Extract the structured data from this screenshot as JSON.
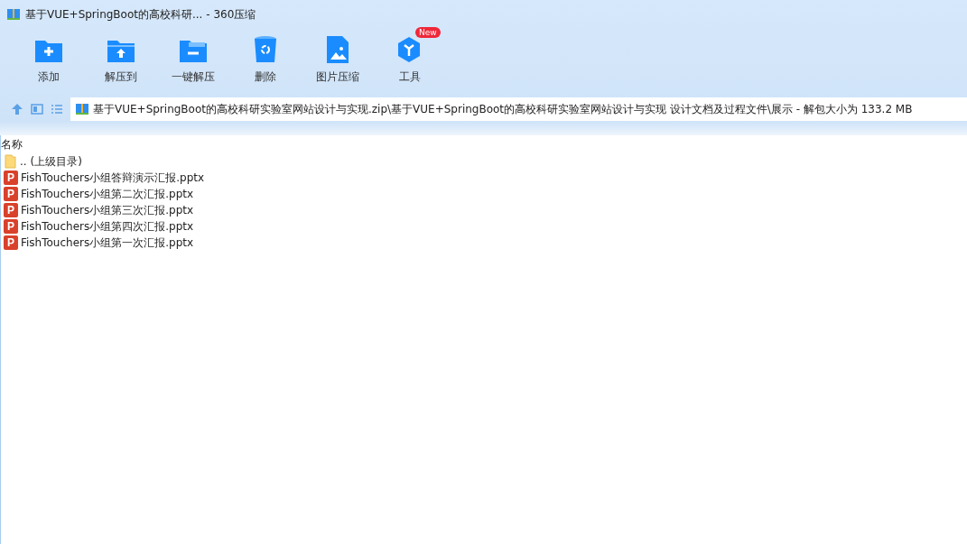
{
  "window": {
    "title": "基于VUE+SpringBoot的高校科研... - 360压缩"
  },
  "toolbar": [
    {
      "kind": "add",
      "label": "添加"
    },
    {
      "kind": "extract",
      "label": "解压到"
    },
    {
      "kind": "oneclick",
      "label": "一键解压"
    },
    {
      "kind": "delete",
      "label": "删除"
    },
    {
      "kind": "image",
      "label": "图片压缩"
    },
    {
      "kind": "tools",
      "label": "工具",
      "badge": "New"
    }
  ],
  "address": {
    "path": "基于VUE+SpringBoot的高校科研实验室网站设计与实现.zip\\基于VUE+SpringBoot的高校科研实验室网站设计与实现 设计文档及过程文件\\展示 - 解包大小为 133.2 MB"
  },
  "table": {
    "columns": [
      "名称"
    ],
    "rows": [
      {
        "kind": "folder",
        "name": ".. (上级目录)"
      },
      {
        "kind": "pptx",
        "icon": "P",
        "name": "FishTouchers小组答辩演示汇报.pptx"
      },
      {
        "kind": "pptx",
        "icon": "P",
        "name": "FishTouchers小组第二次汇报.pptx"
      },
      {
        "kind": "pptx",
        "icon": "P",
        "name": "FishTouchers小组第三次汇报.pptx"
      },
      {
        "kind": "pptx",
        "icon": "P",
        "name": "FishTouchers小组第四次汇报.pptx"
      },
      {
        "kind": "pptx",
        "icon": "P",
        "name": "FishTouchers小组第一次汇报.pptx"
      }
    ]
  }
}
